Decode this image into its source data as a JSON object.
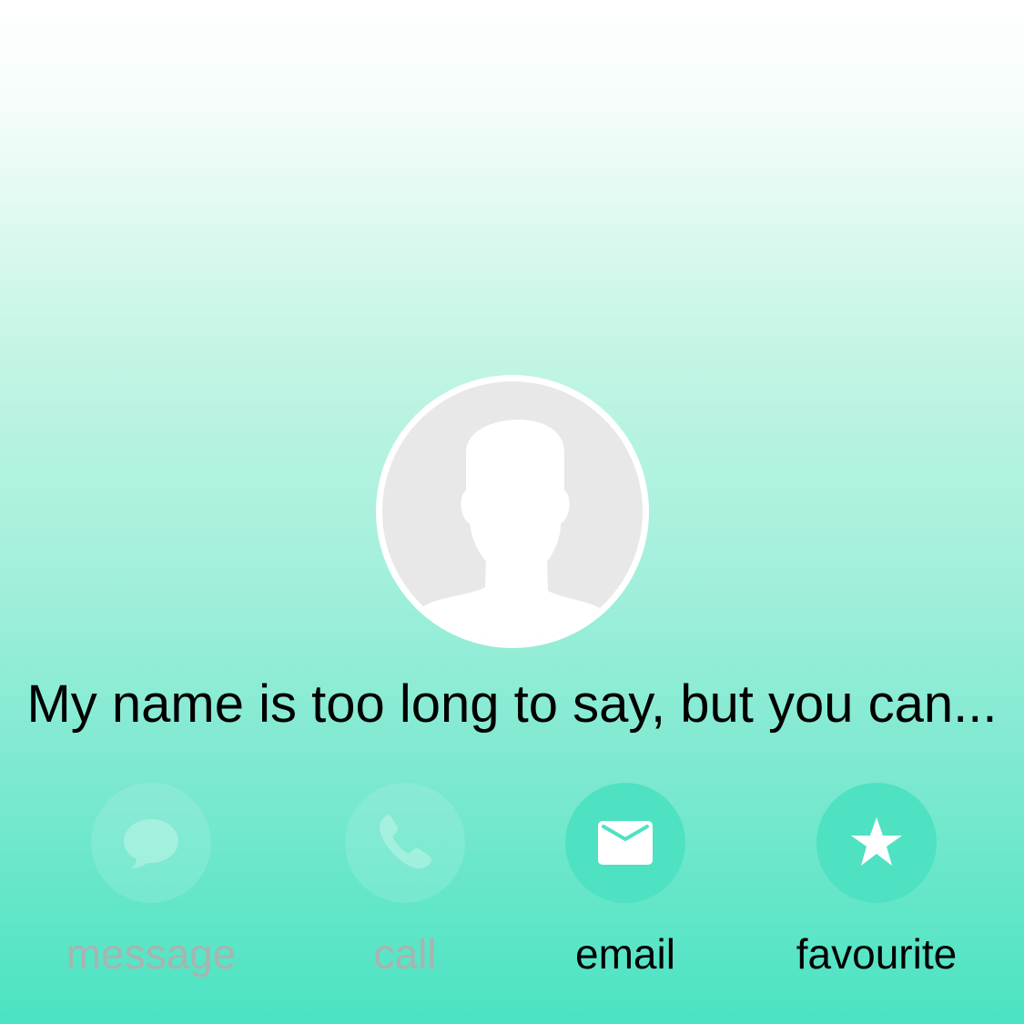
{
  "contact": {
    "name": "My name is too long to say, but you can..."
  },
  "actions": [
    {
      "label": "message",
      "icon": "message-bubble-icon",
      "enabled": false
    },
    {
      "label": "call",
      "icon": "phone-icon",
      "enabled": false
    },
    {
      "label": "email",
      "icon": "envelope-icon",
      "enabled": true
    },
    {
      "label": "favourite",
      "icon": "star-icon",
      "enabled": true
    }
  ],
  "colors": {
    "accent": "#4ee2c2",
    "gradient_top": "#ffffff",
    "gradient_bottom": "#4be3c2",
    "disabled_text": "#a9b3b0",
    "avatar_background": "#e8e8e8"
  }
}
